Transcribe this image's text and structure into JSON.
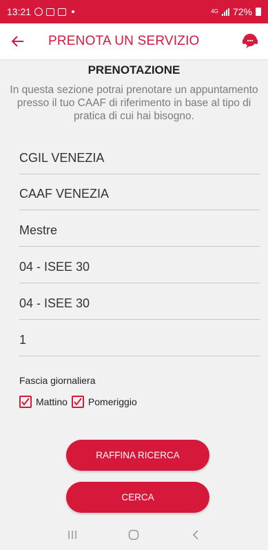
{
  "status_bar": {
    "time": "13:21",
    "network": "4G",
    "battery": "72%"
  },
  "header": {
    "title": "PRENOTA UN SERVIZIO",
    "icons": {
      "back": "back-arrow-icon",
      "support": "support-chat-icon"
    }
  },
  "section": {
    "title": "PRENOTAZIONE",
    "description": "In questa sezione potrai prenotare un appuntamento presso il tuo CAAF di riferimento in base al tipo di pratica di cui hai bisogno."
  },
  "fields": [
    {
      "value": "CGIL VENEZIA"
    },
    {
      "value": "CAAF VENEZIA"
    },
    {
      "value": "Mestre"
    },
    {
      "value": "04 - ISEE 30"
    },
    {
      "value": "04 - ISEE 30"
    },
    {
      "value": "1"
    }
  ],
  "fascia": {
    "label": "Fascia giornaliera",
    "options": [
      {
        "label": "Mattino",
        "checked": true
      },
      {
        "label": "Pomeriggio",
        "checked": true
      }
    ]
  },
  "buttons": {
    "refine": "RAFFINA RICERCA",
    "search": "CERCA"
  },
  "colors": {
    "accent": "#d6183b",
    "background": "#f1f1f1"
  }
}
